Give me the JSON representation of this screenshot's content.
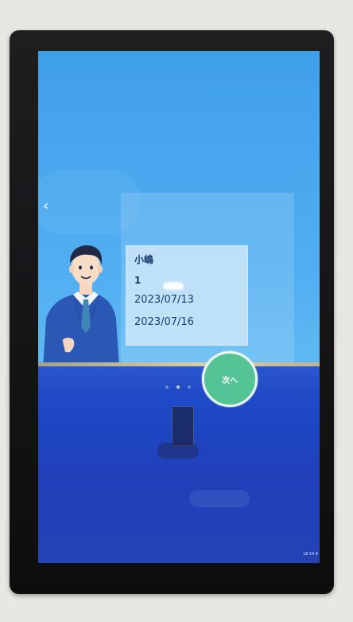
{
  "screen": {
    "back_icon": "chevron-left-icon",
    "card": {
      "fields": [
        {
          "label": "",
          "value": "小嶋"
        },
        {
          "label": "",
          "value": "1"
        },
        {
          "label": "",
          "value": "2023/07/13"
        },
        {
          "label": "",
          "value": "2023/07/16"
        }
      ]
    },
    "next_button_label": "次へ",
    "page_indicator": {
      "count": 3,
      "active_index": 1
    },
    "version_label": "v8.14.4"
  },
  "colors": {
    "upper_background": "#52aff2",
    "lower_background": "#1f4fd0",
    "next_button": "#54c497",
    "gold_line": "#d8cfa6"
  }
}
